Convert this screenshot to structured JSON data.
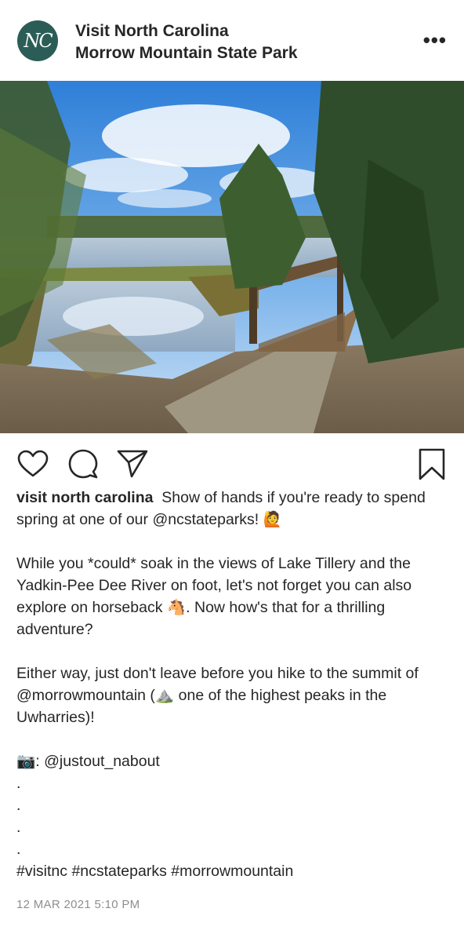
{
  "header": {
    "avatar_text": "NC",
    "account_name": "Visit North Carolina",
    "location": "Morrow Mountain State Park",
    "more_label": "•••"
  },
  "photo": {
    "icon": "photo-boardwalk-lake"
  },
  "actions": {
    "like_icon": "heart-icon",
    "comment_icon": "comment-icon",
    "share_icon": "paper-plane-icon",
    "save_icon": "bookmark-icon"
  },
  "caption": {
    "username": "visit north carolina",
    "line1": "Show of hands if you're ready to spend spring at one of our @ncstateparks! 🙋",
    "para2": "While you *could* soak in the views of Lake Tillery and the Yadkin-Pee Dee River on foot, let's not forget you can also explore on horseback 🐴. Now how's that for a thrilling adventure?",
    "para3": "Either way, just don't leave before you hike to the summit of @morrowmountain (⛰️ one of the highest peaks in the Uwharries)!",
    "credit": "📷: @justout_nabout",
    "dot": ".",
    "hashtags": "#visitnc #ncstateparks #morrowmountain"
  },
  "date": "12 MAR 2021 5:10 PM",
  "colors": {
    "avatar_bg": "#2b5d56",
    "text": "#262626",
    "date": "#8e8e8e"
  }
}
